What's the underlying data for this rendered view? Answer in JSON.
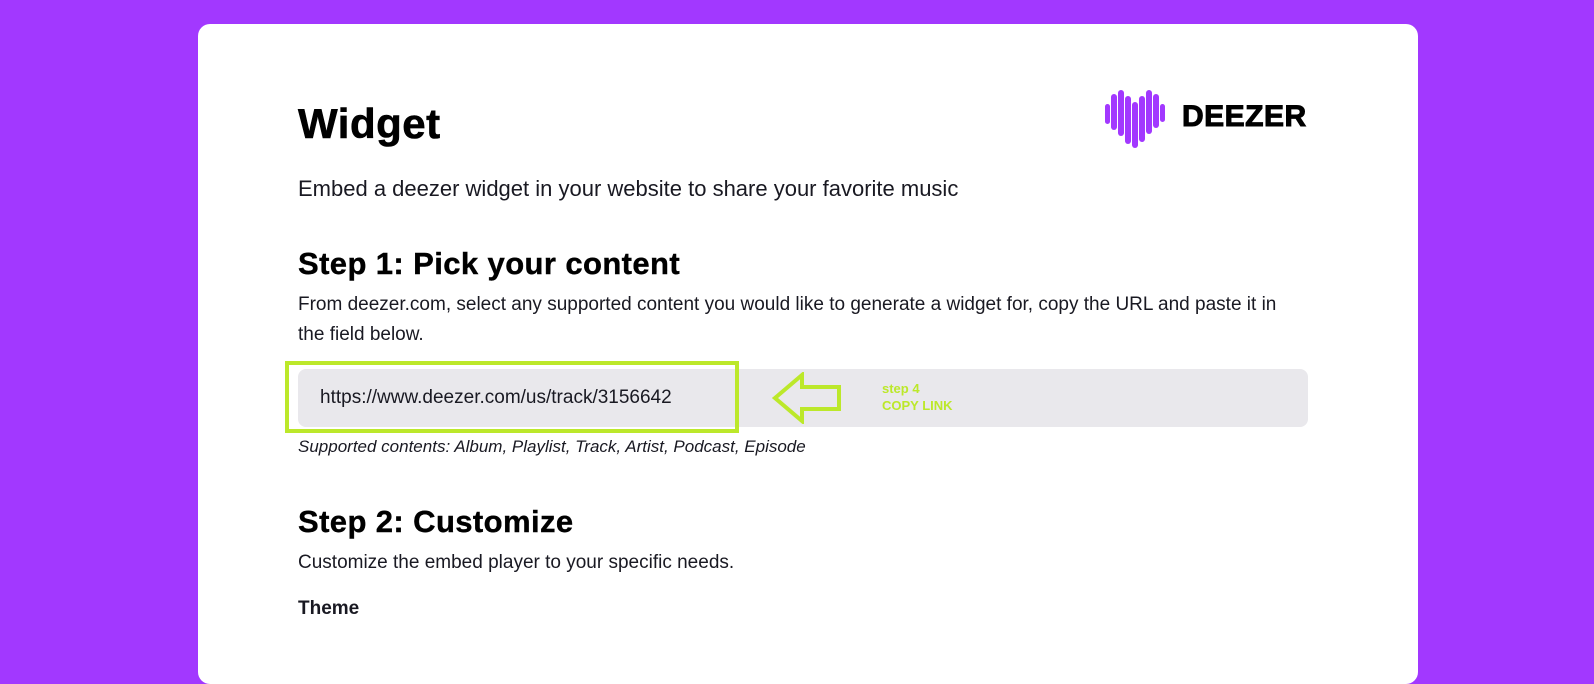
{
  "page": {
    "title": "Widget",
    "lead": "Embed a deezer widget in your website to share your favorite music"
  },
  "logo": {
    "text": "DEEZER",
    "icon": "deezer-heart-icon",
    "color": "#a238ff"
  },
  "step1": {
    "title": "Step 1: Pick your content",
    "description": "From deezer.com, select any supported content you would like to generate a widget for, copy the URL and paste it in the field below.",
    "url_value": "https://www.deezer.com/us/track/3156642",
    "supported": "Supported contents: Album, Playlist, Track, Artist, Podcast, Episode"
  },
  "annotation": {
    "step": "step 4",
    "action": "COPY LINK",
    "color": "#bce82a",
    "icon": "left-arrow-icon"
  },
  "step2": {
    "title": "Step 2: Customize",
    "description": "Customize the embed player to your specific needs.",
    "theme_label": "Theme"
  },
  "colors": {
    "background": "#a238ff",
    "card": "#ffffff",
    "input_bg": "#e9e8ec"
  }
}
